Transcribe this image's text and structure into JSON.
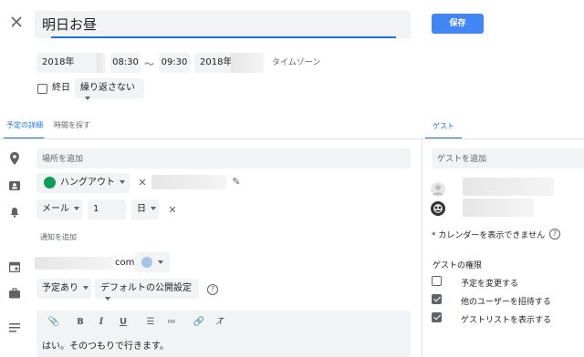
{
  "header": {
    "title": "明日お昼",
    "save_label": "保存"
  },
  "datetime": {
    "start_date": "2018年",
    "start_time": "08:30",
    "separator": "〜",
    "end_time": "09:30",
    "end_date": "2018年",
    "timezone_label": "タイムゾーン",
    "all_day_label": "終日",
    "repeat_label": "繰り返さない"
  },
  "tabs": {
    "details": "予定の詳細",
    "find_time": "時間を探す",
    "guests": "ゲスト"
  },
  "details": {
    "location_placeholder": "場所を追加",
    "conference_label": "ハングアウト",
    "notification_type": "メール",
    "notification_value": "1",
    "notification_unit": "日",
    "add_notification": "通知を追加",
    "calendar_suffix": "com",
    "calendar_color": "#a4c5e8",
    "availability": "予定あり",
    "visibility": "デフォルトの公開設定",
    "description_text": "はい。そのつもりで行きます。"
  },
  "guests": {
    "add_placeholder": "ゲストを追加",
    "calendar_notice": "* カレンダーを表示できません",
    "permissions_title": "ゲストの権限",
    "permissions": [
      {
        "label": "予定を変更する",
        "checked": false
      },
      {
        "label": "他のユーザーを招待する",
        "checked": true
      },
      {
        "label": "ゲストリストを表示する",
        "checked": true
      }
    ]
  },
  "colors": {
    "accent": "#1a73e8",
    "save_button": "#4285f4",
    "hangouts_green": "#0f9d58"
  }
}
